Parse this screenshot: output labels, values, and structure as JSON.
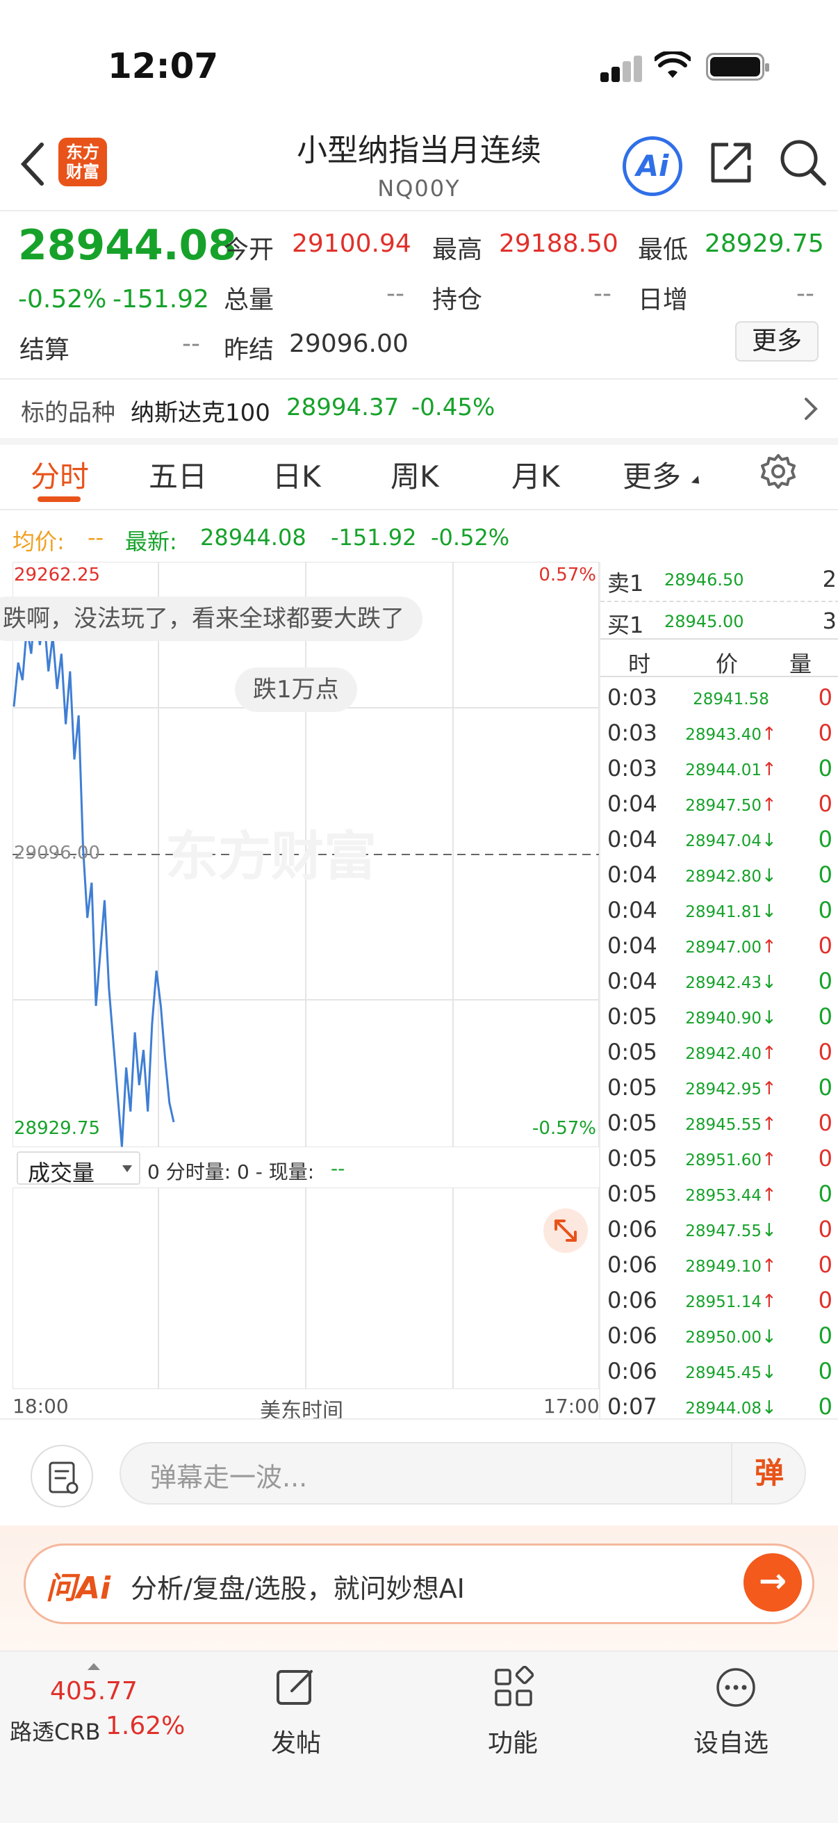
{
  "status": {
    "time": "12:07"
  },
  "nav": {
    "title": "小型纳指当月连续",
    "code": "NQ00Y",
    "logo_text": "东方财富",
    "ai_label": "Ai"
  },
  "quote": {
    "price": "28944.08",
    "change_pct": "-0.52%",
    "change": "-151.92",
    "open_label": "今开",
    "open": "29100.94",
    "high_label": "最高",
    "high": "29188.50",
    "low_label": "最低",
    "low": "28929.75",
    "volume_label": "总量",
    "volume": "--",
    "position_label": "持仓",
    "position": "--",
    "daily_inc_label": "日增",
    "daily_inc": "--",
    "settle_label": "结算",
    "settle": "--",
    "prev_settle_label": "昨结",
    "prev_settle": "29096.00",
    "more_label": "更多"
  },
  "underlying": {
    "label": "标的品种",
    "name": "纳斯达克100",
    "price": "28994.37",
    "change": "-0.45%"
  },
  "tabs": [
    {
      "label": "分时",
      "active": true
    },
    {
      "label": "五日"
    },
    {
      "label": "日K"
    },
    {
      "label": "周K"
    },
    {
      "label": "月K"
    },
    {
      "label": "更多"
    }
  ],
  "chart_info": {
    "avg_label": "均价:",
    "avg_value": "--",
    "latest_label": "最新:",
    "latest_value": "28944.08",
    "latest_change": "-151.92",
    "latest_pct": "-0.52%"
  },
  "chart": {
    "y_high": "29262.25",
    "y_low": "28929.75",
    "pct_high": "0.57%",
    "pct_low": "-0.57%",
    "mid_label": "29096.00",
    "watermark": "东方财富",
    "x_start": "18:00",
    "x_mid": "美东时间",
    "x_end": "17:00",
    "danmu": [
      "跌啊，没法玩了，看来全球都要大跌了",
      "跌1万点"
    ]
  },
  "volume_bar": {
    "selector": "成交量",
    "info_prefix": "0 分时量: 0 - 现量:",
    "info_value": "--"
  },
  "chart_data": {
    "type": "line",
    "xlabel": "美东时间",
    "x_range": [
      "18:00",
      "17:00"
    ],
    "ylim": [
      28929.75,
      29262.25
    ],
    "reference": 29096.0,
    "series": [
      {
        "values": [
          29180,
          29205,
          29195,
          29225,
          29210,
          29240,
          29215,
          29230,
          29200,
          29220,
          29190,
          29210,
          29170,
          29200,
          29150,
          29175,
          29100,
          29060,
          29080,
          29010,
          29040,
          29070,
          29020,
          28990,
          28960,
          28930,
          28975,
          28950,
          28995,
          28965,
          28985,
          28950,
          29000,
          29030,
          29010,
          28980,
          28955,
          28944
        ]
      }
    ]
  },
  "order_book": {
    "sell1_label": "卖1",
    "sell1_price": "28946.50",
    "sell1_vol": "2",
    "buy1_label": "买1",
    "buy1_price": "28945.00",
    "buy1_vol": "3"
  },
  "ticks_header": {
    "time": "时",
    "price": "价",
    "vol": "量"
  },
  "ticks": [
    {
      "time": "0:03",
      "price": "28941.58",
      "dir": "",
      "vol": "0",
      "pc": "green",
      "vc": "red"
    },
    {
      "time": "0:03",
      "price": "28943.40",
      "dir": "↑",
      "vol": "0",
      "pc": "green",
      "vc": "red"
    },
    {
      "time": "0:03",
      "price": "28944.01",
      "dir": "↑",
      "vol": "0",
      "pc": "green",
      "vc": "green"
    },
    {
      "time": "0:04",
      "price": "28947.50",
      "dir": "↑",
      "vol": "0",
      "pc": "green",
      "vc": "red"
    },
    {
      "time": "0:04",
      "price": "28947.04",
      "dir": "↓",
      "vol": "0",
      "pc": "green",
      "vc": "green"
    },
    {
      "time": "0:04",
      "price": "28942.80",
      "dir": "↓",
      "vol": "0",
      "pc": "green",
      "vc": "green"
    },
    {
      "time": "0:04",
      "price": "28941.81",
      "dir": "↓",
      "vol": "0",
      "pc": "green",
      "vc": "green"
    },
    {
      "time": "0:04",
      "price": "28947.00",
      "dir": "↑",
      "vol": "0",
      "pc": "green",
      "vc": "red"
    },
    {
      "time": "0:04",
      "price": "28942.43",
      "dir": "↓",
      "vol": "0",
      "pc": "green",
      "vc": "green"
    },
    {
      "time": "0:05",
      "price": "28940.90",
      "dir": "↓",
      "vol": "0",
      "pc": "green",
      "vc": "green"
    },
    {
      "time": "0:05",
      "price": "28942.40",
      "dir": "↑",
      "vol": "0",
      "pc": "green",
      "vc": "red"
    },
    {
      "time": "0:05",
      "price": "28942.95",
      "dir": "↑",
      "vol": "0",
      "pc": "green",
      "vc": "green"
    },
    {
      "time": "0:05",
      "price": "28945.55",
      "dir": "↑",
      "vol": "0",
      "pc": "green",
      "vc": "red"
    },
    {
      "time": "0:05",
      "price": "28951.60",
      "dir": "↑",
      "vol": "0",
      "pc": "green",
      "vc": "red"
    },
    {
      "time": "0:05",
      "price": "28953.44",
      "dir": "↑",
      "vol": "0",
      "pc": "green",
      "vc": "green"
    },
    {
      "time": "0:06",
      "price": "28947.55",
      "dir": "↓",
      "vol": "0",
      "pc": "green",
      "vc": "red"
    },
    {
      "time": "0:06",
      "price": "28949.10",
      "dir": "↑",
      "vol": "0",
      "pc": "green",
      "vc": "red"
    },
    {
      "time": "0:06",
      "price": "28951.14",
      "dir": "↑",
      "vol": "0",
      "pc": "green",
      "vc": "red"
    },
    {
      "time": "0:06",
      "price": "28950.00",
      "dir": "↓",
      "vol": "0",
      "pc": "green",
      "vc": "green"
    },
    {
      "time": "0:06",
      "price": "28945.45",
      "dir": "↓",
      "vol": "0",
      "pc": "green",
      "vc": "green"
    },
    {
      "time": "0:07",
      "price": "28944.08",
      "dir": "↓",
      "vol": "0",
      "pc": "green",
      "vc": "green"
    }
  ],
  "comment": {
    "placeholder": "弹幕走一波...",
    "danmu_button": "弹"
  },
  "ai_bar": {
    "logo": "问Ai",
    "text": "分析/复盘/选股，就问妙想AI"
  },
  "bottom_nav": {
    "index_value": "405.77",
    "index_name": "路透CRB",
    "index_pct": "1.62%",
    "post_label": "发帖",
    "func_label": "功能",
    "watch_label": "设自选"
  },
  "colors": {
    "up": "#e0302a",
    "down": "#16a22a",
    "accent": "#e8531a",
    "line": "#3f7ed4"
  }
}
